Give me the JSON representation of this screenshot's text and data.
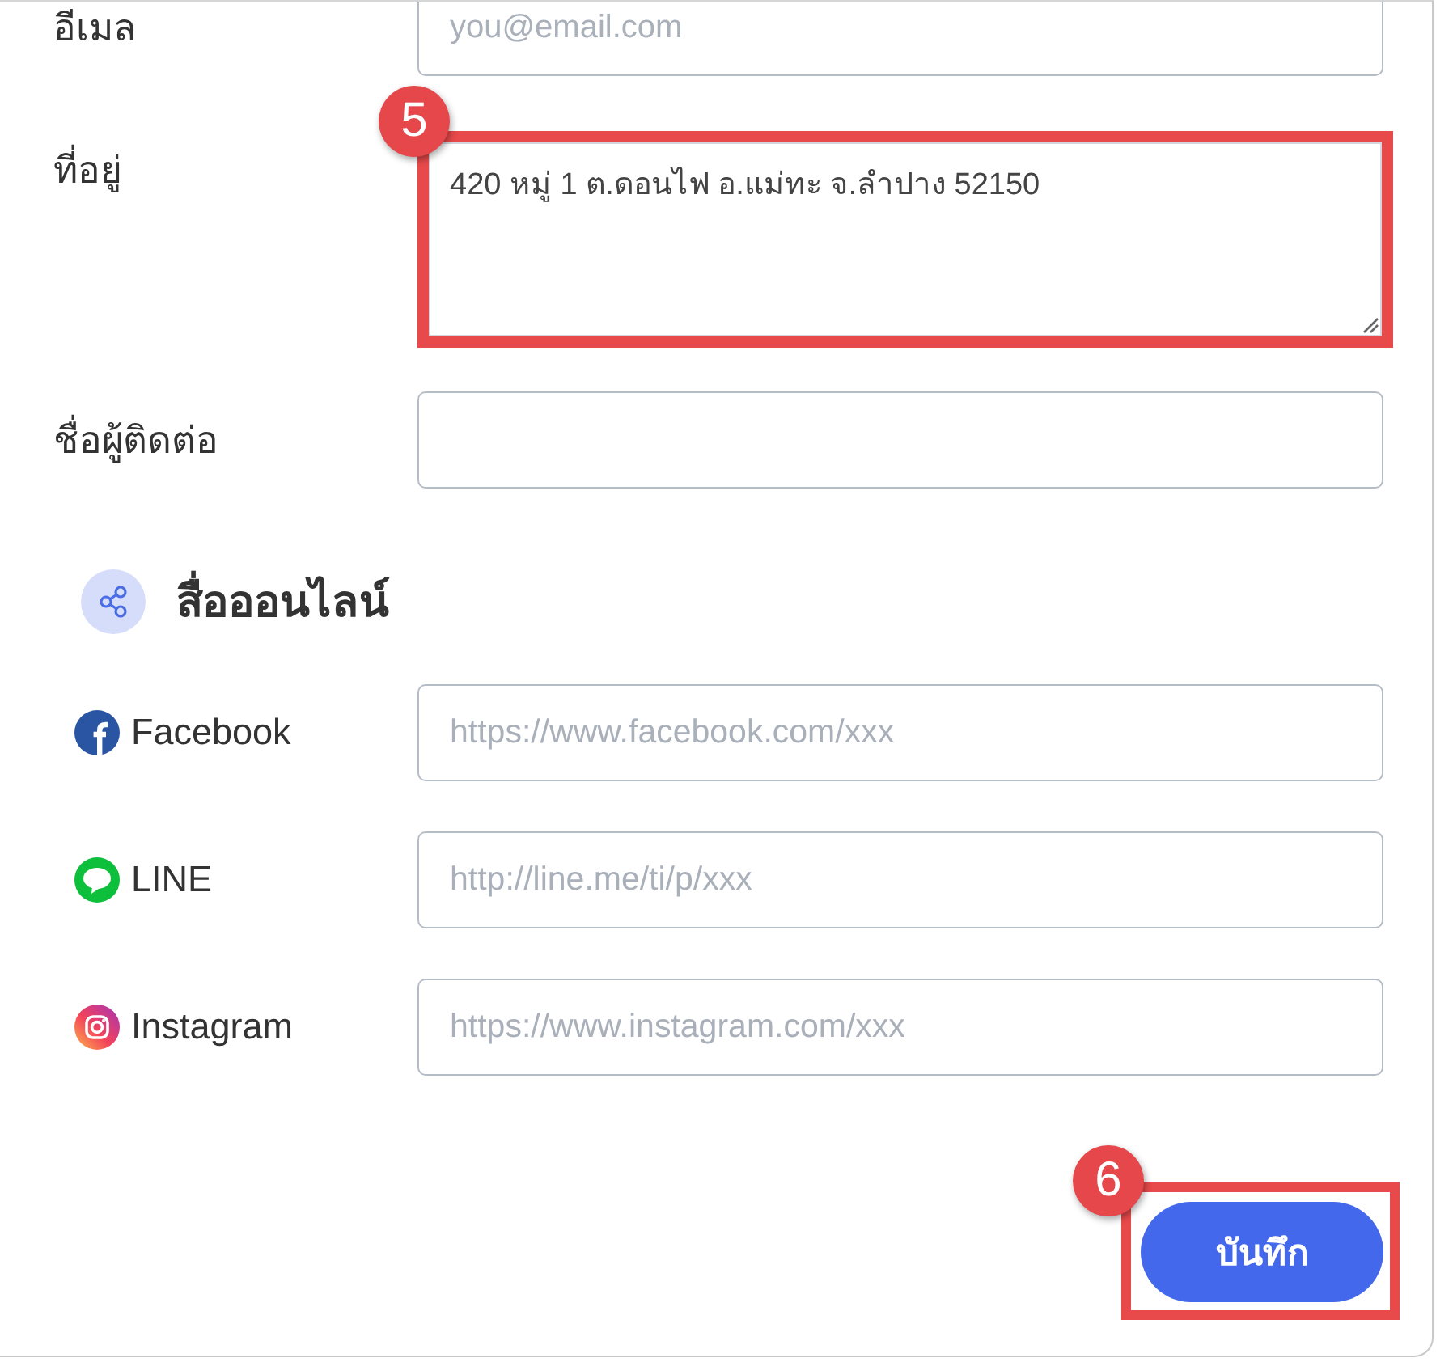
{
  "fields": [
    {
      "kind": "input",
      "label": "อีเมล",
      "placeholder": "you@email.com"
    },
    {
      "kind": "textarea",
      "label": "ที่อยู่",
      "value": "420 หมู่ 1 ต.ดอนไฟ อ.แม่ทะ จ.ลำปาง 52150",
      "callout": "5"
    },
    {
      "kind": "input",
      "label": "ชื่อผู้ติดต่อ"
    }
  ],
  "online_section": {
    "title": "สื่อออนไลน์",
    "links": [
      {
        "kind": "facebook",
        "label": "Facebook",
        "placeholder": "https://www.facebook.com/xxx"
      },
      {
        "kind": "line",
        "label": "LINE",
        "placeholder": "http://line.me/ti/p/xxx"
      },
      {
        "kind": "instagram",
        "label": "Instagram",
        "placeholder": "https://www.instagram.com/xxx"
      }
    ]
  },
  "save_button": {
    "label": "บันทึก",
    "callout": "6"
  }
}
